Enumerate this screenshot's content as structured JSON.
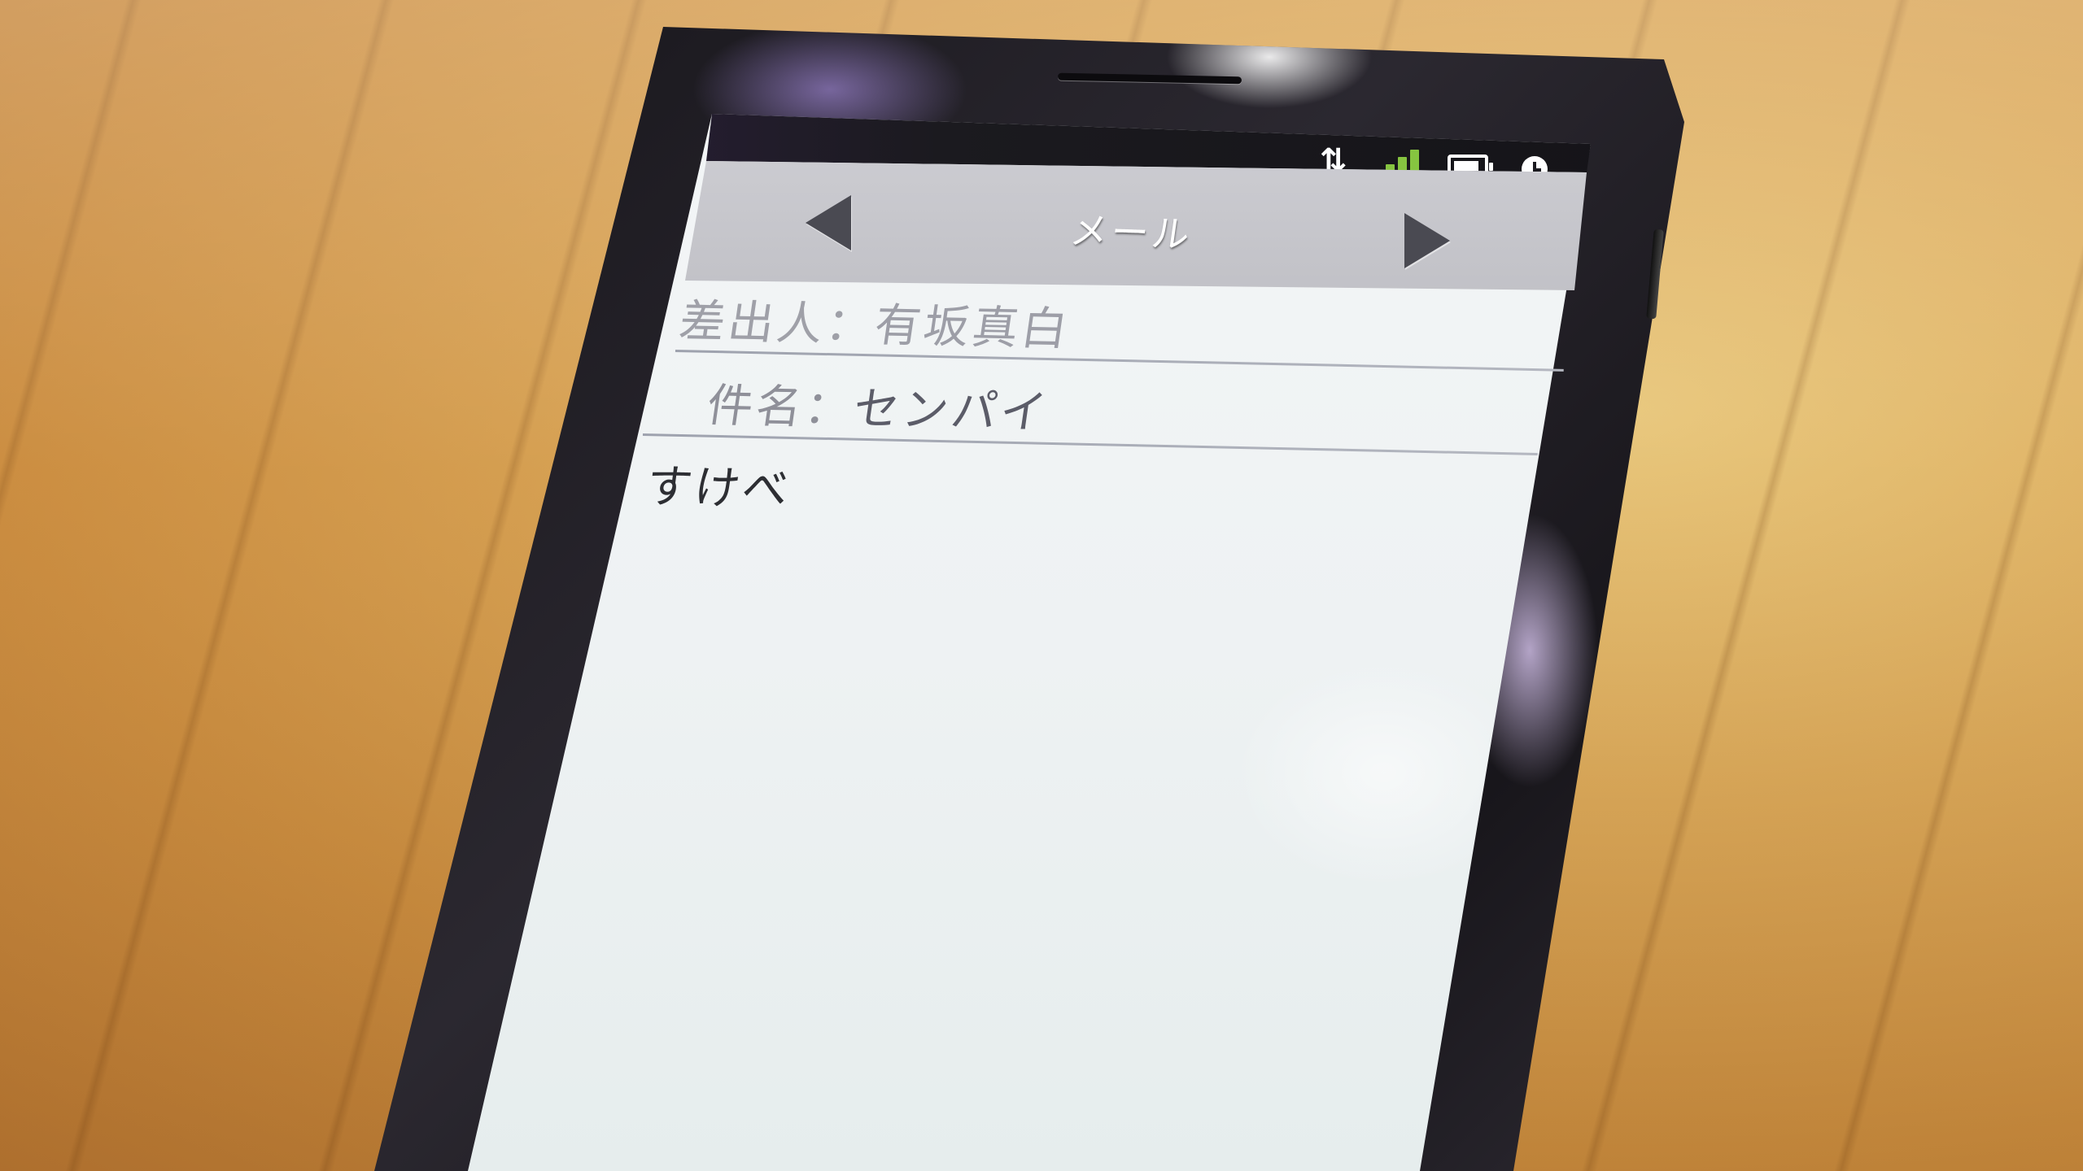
{
  "status_bar": {
    "transfer_icon": "⇅",
    "signal_icon": "signal-bars-icon",
    "battery_icon": "battery-icon",
    "clock_icon": "clock-icon",
    "signal_color": "#86c440"
  },
  "header": {
    "title": "メール",
    "prev_icon": "left-triangle-icon",
    "next_icon": "right-triangle-icon"
  },
  "mail": {
    "sender_label": "差出人：",
    "sender_value": "有坂真白",
    "subject_label": "件名：",
    "subject_value": "センパイ",
    "body": "すけべ"
  }
}
